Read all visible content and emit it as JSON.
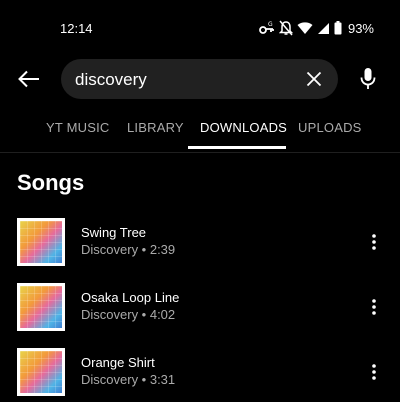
{
  "status_bar": {
    "time": "12:14",
    "battery": "93%",
    "icons": [
      "key-icon",
      "notifications-off-icon",
      "wifi-icon",
      "signal-icon",
      "battery-icon"
    ]
  },
  "search": {
    "query": "discovery",
    "back_icon": "arrow-left-icon",
    "clear_icon": "close-icon",
    "mic_icon": "microphone-icon"
  },
  "tabs": [
    {
      "label": "YT MUSIC",
      "active": false
    },
    {
      "label": "LIBRARY",
      "active": false
    },
    {
      "label": "DOWNLOADS",
      "active": true
    },
    {
      "label": "UPLOADS",
      "active": false
    }
  ],
  "section": {
    "title": "Songs"
  },
  "songs": [
    {
      "title": "Swing Tree",
      "subtitle": "Discovery • 2:39"
    },
    {
      "title": "Osaka Loop Line",
      "subtitle": "Discovery • 4:02"
    },
    {
      "title": "Orange Shirt",
      "subtitle": "Discovery • 3:31"
    }
  ],
  "colors": {
    "background": "#000000",
    "search_pill": "#212121",
    "text_secondary": "#aaaaaa"
  }
}
